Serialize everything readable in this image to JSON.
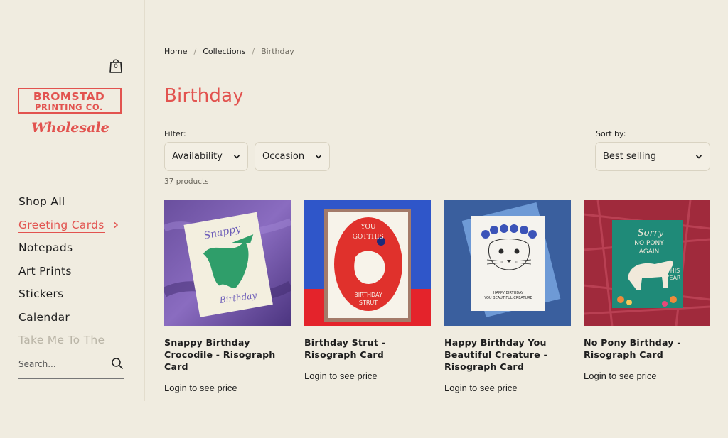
{
  "header": {
    "cart_count": "0"
  },
  "logo": {
    "line1": "BROMSTAD",
    "line2": "PRINTING CO.",
    "script": "Wholesale"
  },
  "sidebar": {
    "items": [
      {
        "label": "Shop All"
      },
      {
        "label": "Greeting Cards"
      },
      {
        "label": "Notepads"
      },
      {
        "label": "Art Prints"
      },
      {
        "label": "Stickers"
      },
      {
        "label": "Calendar"
      },
      {
        "label": "Take Me To The"
      }
    ],
    "search": {
      "placeholder": "Search..."
    }
  },
  "breadcrumb": {
    "home": "Home",
    "collections": "Collections",
    "current": "Birthday",
    "separator": "/"
  },
  "page": {
    "title": "Birthday",
    "filter_label": "Filter:",
    "sort_label": "Sort by:",
    "filters": {
      "availability": "Availability",
      "occasion": "Occasion"
    },
    "sort_value": "Best selling",
    "product_count": "37 products"
  },
  "products": [
    {
      "title": "Snappy Birthday Crocodile - Risograph Card",
      "price": "Login to see price",
      "card_text": [
        "Snappy",
        "Birthday"
      ]
    },
    {
      "title": "Birthday Strut - Risograph Card",
      "price": "Login to see price",
      "card_text": [
        "YOU",
        "GOT",
        "THIS",
        "BIRTHDAY",
        "STRUT"
      ]
    },
    {
      "title": "Happy Birthday You Beautiful Creature - Risograph Card",
      "price": "Login to see price",
      "card_text": [
        "HAPPY BIRTHDAY",
        "YOU BEAUTIFUL CREATURE"
      ]
    },
    {
      "title": "No Pony Birthday - Risograph Card",
      "price": "Login to see price",
      "card_text": [
        "Sorry",
        "NO PONY",
        "AGAIN",
        "THIS",
        "YEAR"
      ]
    }
  ],
  "colors": {
    "background": "#f0ece0",
    "accent": "#e2534f",
    "text": "#1e1e1e"
  }
}
